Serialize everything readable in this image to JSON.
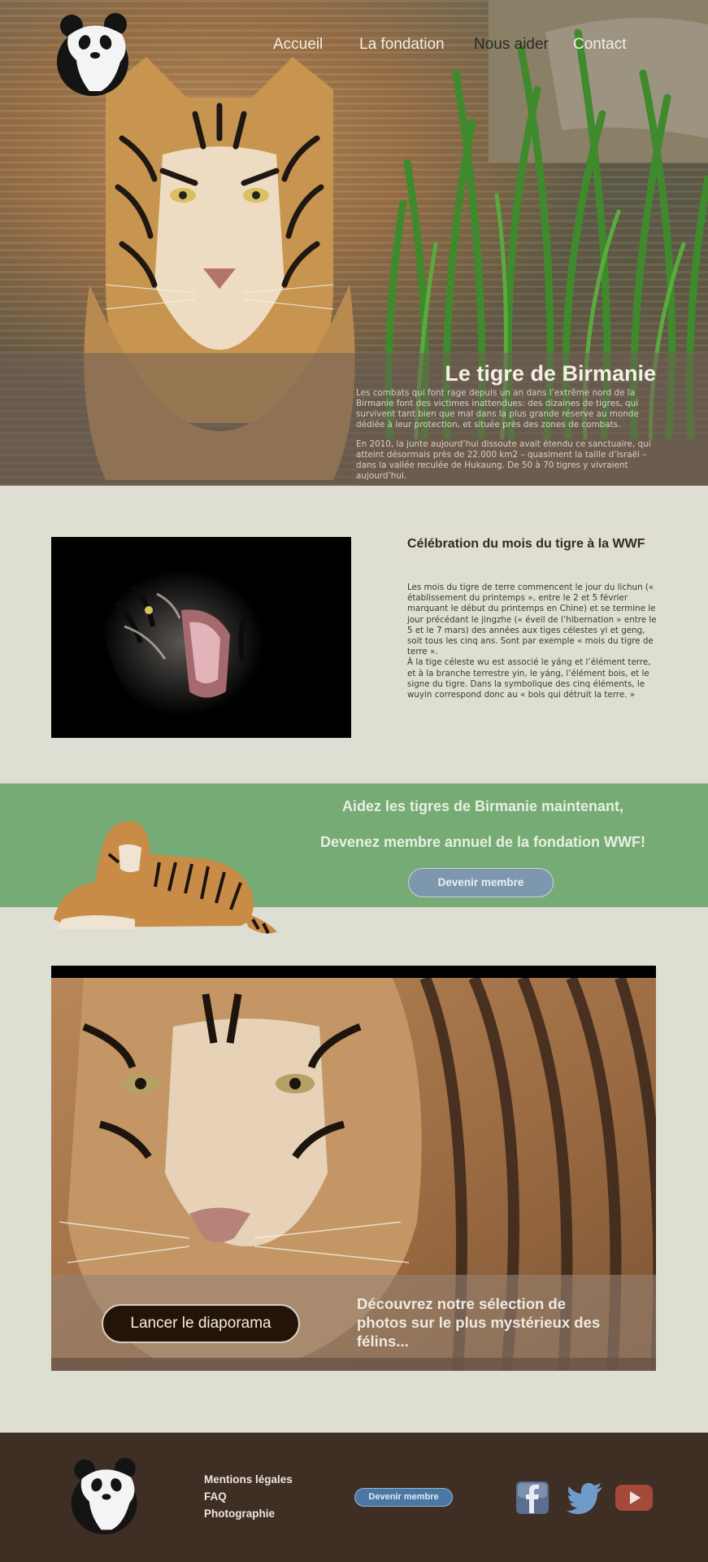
{
  "nav": {
    "items": [
      "Accueil",
      "La fondation",
      "Nous aider",
      "Contact"
    ]
  },
  "hero": {
    "title": "Le tigre de Birmanie",
    "paragraphs": [
      "Les combats qui font rage depuis un an dans l’extrême nord de la Birmanie font des victimes inattendues: des dizaines de tigres, qui survivent tant bien que mal dans la plus grande réserve au monde dédiée à leur protection, et située près des zones de combats.",
      "En 2010, la junte aujourd’hui dissoute avait étendu ce sanctuaire, qui atteint désormais près de 22.000 km2 – quasiment la taille d’Israël – dans la vallée reculée de Hukaung. De 50 à 70 tigres y vivraient aujourd’hui."
    ]
  },
  "celebration": {
    "title": "Célébration du mois du tigre à la WWF",
    "paragraph1": "Les mois du tigre de terre commencent le jour du lichun (« établissement du printemps », entre le 2 et 5 février marquant le début du printemps en Chine) et se termine le jour précédant le jingzhe (« éveil de l’hibernation » entre le 5 et le 7 mars) des années aux tiges célestes yi et geng, soit tous les cinq ans. Sont par exemple « mois du tigre de terre ».",
    "paragraph2": "À la tige céleste wu est associé le yáng et l’élément terre, et à la branche terrestre yin, le yáng, l’élément bois, et le signe du tigre. Dans la symbolique des cinq éléments, le wuyin correspond donc au « bois qui détruit la terre. »"
  },
  "donate": {
    "line1": "Aidez les tigres de Birmanie maintenant,",
    "line2": "Devenez membre annuel de la fondation WWF!",
    "button": "Devenir membre"
  },
  "gallery": {
    "button": "Lancer le diaporama",
    "caption": "Découvrez notre sélection de photos sur le plus mystérieux des félins..."
  },
  "footer": {
    "links": [
      "Mentions légales",
      "FAQ",
      "Photographie"
    ],
    "button": "Devenir membre",
    "social": [
      "facebook-icon",
      "twitter-icon",
      "youtube-icon"
    ]
  },
  "colors": {
    "page_bg": "#dedfd2",
    "band_green": "#77ab76",
    "footer_brown": "#3e2e24",
    "button_blue": "#4a77a3"
  }
}
